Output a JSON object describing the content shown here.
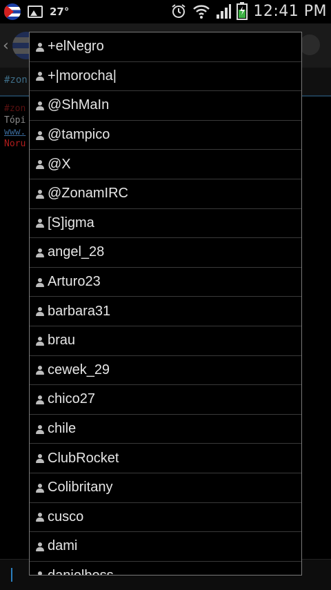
{
  "status_bar": {
    "temperature": "27°",
    "time": "12:41 PM",
    "icons": [
      "cuba-flag-icon",
      "image-icon",
      "alarm-icon",
      "wifi-icon",
      "signal-icon",
      "battery-icon"
    ]
  },
  "background": {
    "tab_label": "#zon",
    "lines": [
      "#zon",
      "Tópi",
      "www.",
      "Noru"
    ]
  },
  "dropdown": {
    "items": [
      "+elNegro",
      "+|morocha|",
      "@ShMaIn",
      "@tampico",
      "@X",
      "@ZonamIRC",
      "[S]igma",
      "angel_28",
      "Arturo23",
      "barbara31",
      "brau",
      "cewek_29",
      "chico27",
      "chile",
      "ClubRocket",
      "Colibritany",
      "cusco",
      "dami",
      "danielboss"
    ]
  },
  "colors": {
    "accent": "#2a7fbf",
    "battery": "#3cb043",
    "background_red_text": "#b01c1c"
  }
}
